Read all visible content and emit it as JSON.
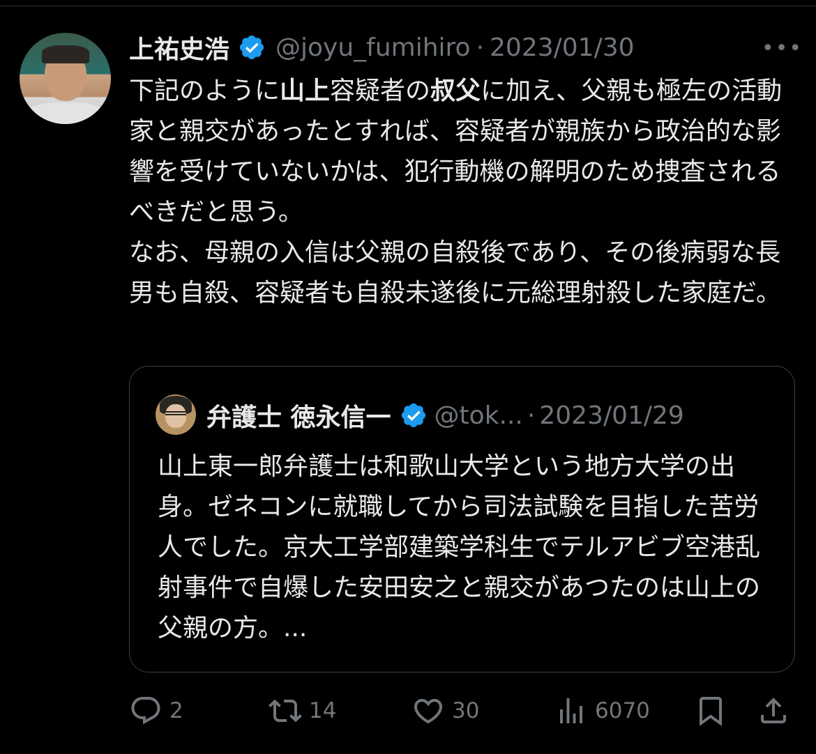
{
  "tweet": {
    "author": {
      "display_name": "上祐史浩",
      "handle": "@joyu_fumihiro",
      "verified": true
    },
    "separator": "·",
    "date": "2023/01/30",
    "more_label": "•••",
    "text": {
      "seg1": "下記のように",
      "seg2_bold": "山上",
      "seg3": "容疑者の",
      "seg4_bold": "叔父",
      "seg5": "に加え、父親も極左の活動家と親交があったとすれば、容疑者が親族から政治的な影響を受けていないかは、犯行動機の解明のため捜査されるべきだと思う。",
      "para2": "なお、母親の入信は父親の自殺後であり、その後病弱な長男も自殺、容疑者も自殺未遂後に元総理射殺した家庭だ。"
    }
  },
  "quoted": {
    "author": {
      "display_name": "弁護士 徳永信一",
      "handle": "@tok...",
      "verified": true
    },
    "separator": "·",
    "date": "2023/01/29",
    "text": "山上東一郎弁護士は和歌山大学という地方大学の出身。ゼネコンに就職してから司法試験を目指した苦労人でした。京大工学部建築学科生でテルアビブ空港乱射事件で自爆した安田安之と親交があつたのは山上の父親の方。..."
  },
  "actions": {
    "reply_count": "2",
    "retweet_count": "14",
    "like_count": "30",
    "views_count": "6070"
  },
  "colors": {
    "background": "#000000",
    "text": "#e7e9ea",
    "muted": "#71767b",
    "verified_blue": "#1d9bf0",
    "border": "#38404a"
  }
}
